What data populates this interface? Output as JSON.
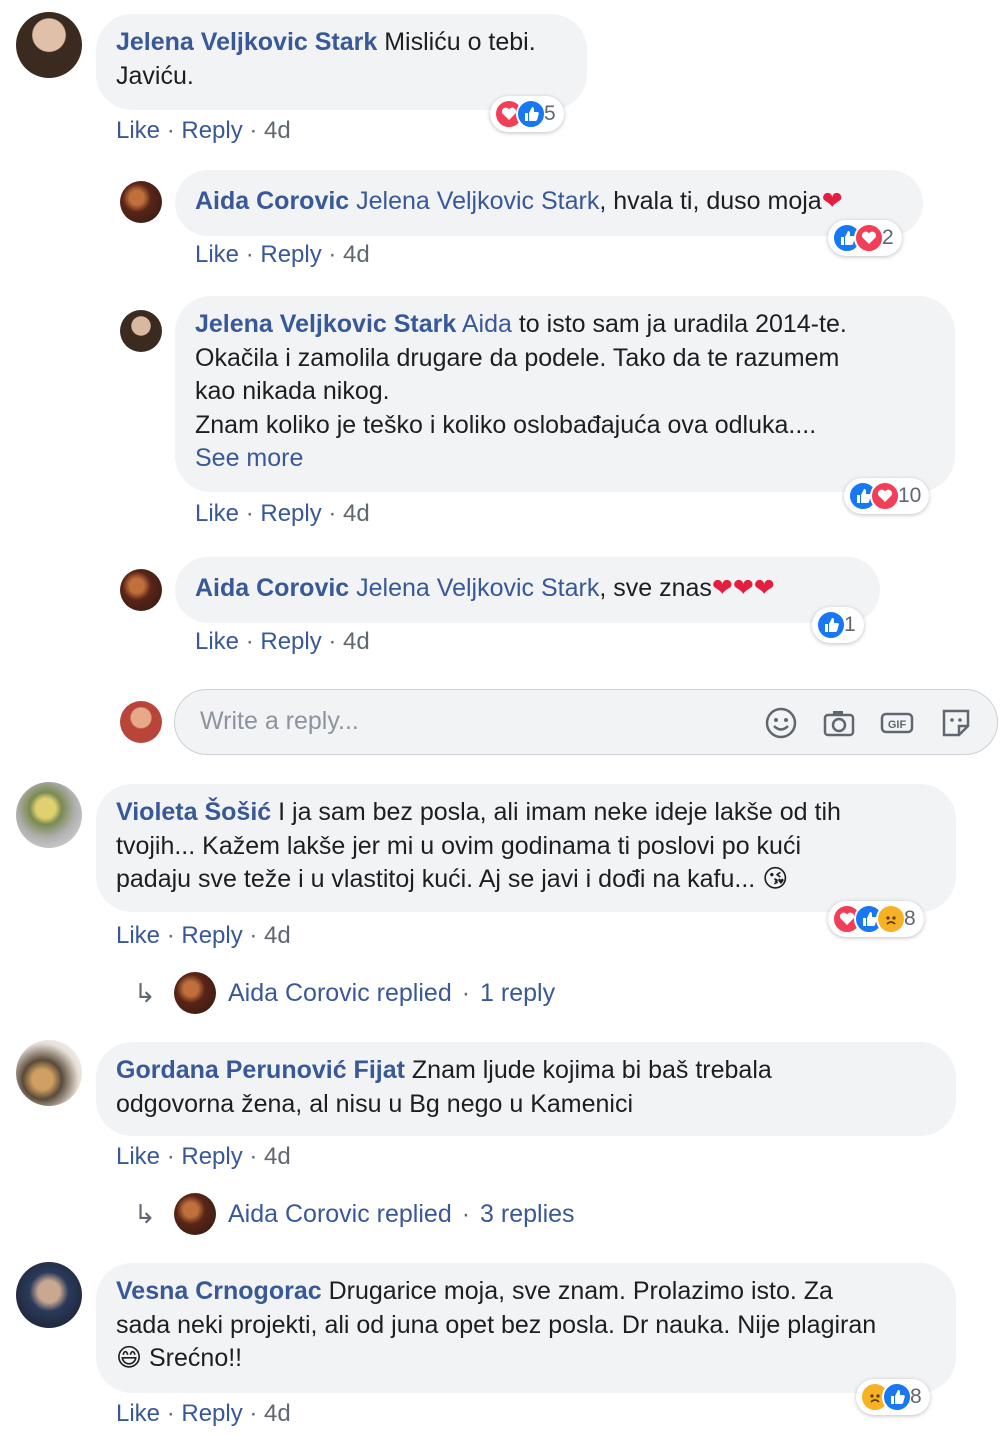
{
  "comments": [
    {
      "author": "Jelena Veljkovic Stark",
      "text": " Misliću o tebi.",
      "text2": "Javiću.",
      "actions": {
        "like": "Like",
        "reply": "Reply",
        "time": "4d"
      },
      "reactions": {
        "icons": [
          "love",
          "like"
        ],
        "count": "5"
      },
      "avatar_color": "#5a4a3a"
    },
    {
      "author": "Aida Corovic",
      "mention": "Jelena Veljkovic Stark",
      "text": ", hvala ti, duso moja",
      "actions": {
        "like": "Like",
        "reply": "Reply",
        "time": "4d"
      },
      "reactions": {
        "icons": [
          "like",
          "love"
        ],
        "count": "2"
      },
      "avatar_color": "#7a3a2a"
    },
    {
      "author": "Jelena Veljkovic Stark",
      "mention": "Aida",
      "line1": " to isto sam ja uradila 2014-te.",
      "line2": "Okačila i zamolila drugare da podele. Tako da te razumem",
      "line3": "kao nikada nikog.",
      "line4": "Znam koliko je teško i koliko oslobađajuća ova odluka....",
      "see_more": "See more",
      "actions": {
        "like": "Like",
        "reply": "Reply",
        "time": "4d"
      },
      "reactions": {
        "icons": [
          "like",
          "love"
        ],
        "count": "10"
      }
    },
    {
      "author": "Aida Corovic",
      "mention": "Jelena Veljkovic Stark",
      "text": ", sve znas",
      "actions": {
        "like": "Like",
        "reply": "Reply",
        "time": "4d"
      },
      "reactions": {
        "icons": [
          "like"
        ],
        "count": "1"
      }
    },
    {
      "author": "Violeta Šošić",
      "line1": " I ja sam bez posla, ali imam neke ideje lakše od tih",
      "line2": "tvojih... Kažem lakše jer mi u ovim godinama ti poslovi po kući",
      "line3": "padaju sve teže i u vlastitoj kući. Aj se javi i dođi na kafu...",
      "actions": {
        "like": "Like",
        "reply": "Reply",
        "time": "4d"
      },
      "reactions": {
        "icons": [
          "love",
          "like",
          "sad"
        ],
        "count": "8"
      },
      "replied": {
        "who": "Aida Corovic replied",
        "count": "1 reply"
      }
    },
    {
      "author": "Gordana Perunović Fijat",
      "line1": " Znam ljude kojima bi baš trebala",
      "line2": "odgovorna žena, al nisu u Bg nego u Kamenici",
      "actions": {
        "like": "Like",
        "reply": "Reply",
        "time": "4d"
      },
      "replied": {
        "who": "Aida Corovic replied",
        "count": "3 replies"
      }
    },
    {
      "author": "Vesna Crnogorac",
      "line1": " Drugarice moja, sve znam. Prolazimo isto. Za",
      "line2": "sada neki projekti, ali od juna opet bez posla. Dr nauka. Nije plagiran",
      "line3": " Srećno!!",
      "actions": {
        "like": "Like",
        "reply": "Reply",
        "time": "4d"
      },
      "reactions": {
        "icons": [
          "sad",
          "like"
        ],
        "count": "8"
      }
    }
  ],
  "reply_box": {
    "placeholder": "Write a reply..."
  },
  "colors": {
    "link": "#385898",
    "bubble": "#f2f3f5",
    "like": "#1877f2",
    "love": "#f33e58",
    "sad": "#f7b125"
  }
}
